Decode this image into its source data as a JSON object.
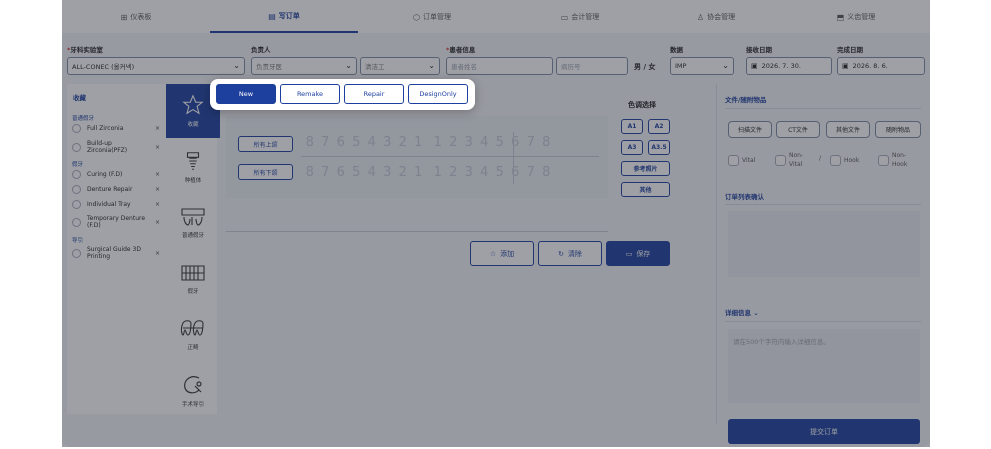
{
  "nav": {
    "tabs": [
      {
        "label": "仪表板",
        "icon": "grid-icon"
      },
      {
        "label": "写订单",
        "icon": "document-icon"
      },
      {
        "label": "订单管理",
        "icon": "box-icon"
      },
      {
        "label": "会计管理",
        "icon": "card-icon"
      },
      {
        "label": "协会管理",
        "icon": "user-icon"
      },
      {
        "label": "义齿管理",
        "icon": "cube-icon"
      }
    ],
    "active_tab": "写订单"
  },
  "form": {
    "lab_label": "牙科实验室",
    "lab_value": "ALL-CONEC (올커넥)",
    "owner_label": "负责人",
    "owner_placeholder": "负责牙医",
    "cleaner_value": "清洁工",
    "patient_label": "患者信息",
    "patient_name_placeholder": "患者姓名",
    "record_placeholder": "病历号",
    "gender_male": "男",
    "gender_sep": "/",
    "gender_female": "女",
    "data_label": "数据",
    "data_value": "IMP",
    "received_label": "接收日期",
    "received_value": "2026. 7. 30.",
    "completed_label": "完成日期",
    "completed_value": "2026. 8. 6."
  },
  "favorites": {
    "title": "收藏",
    "groups": [
      {
        "name": "普通假牙",
        "items": [
          "Full Zirconia",
          "Build-up Zirconia(PFZ)"
        ]
      },
      {
        "name": "假牙",
        "items": [
          "Curing (F.D)",
          "Denture Repair",
          "Individual Tray",
          "Temporary Denture (F.D)"
        ]
      },
      {
        "name": "导引",
        "items": [
          "Surgical Guide 3D Printing"
        ]
      }
    ],
    "remove_symbol": "×"
  },
  "categories": [
    {
      "label": "收藏",
      "icon": "star-icon"
    },
    {
      "label": "种植体",
      "icon": "implant-icon"
    },
    {
      "label": "普通假牙",
      "icon": "crown-bridge-icon"
    },
    {
      "label": "假牙",
      "icon": "denture-icon"
    },
    {
      "label": "正畸",
      "icon": "orthodontic-icon"
    },
    {
      "label": "手术导引",
      "icon": "surgical-guide-icon"
    }
  ],
  "teeth": {
    "upper_all": "所有上颌",
    "lower_all": "所有下颌",
    "upper_left": [
      "8",
      "7",
      "6",
      "5",
      "4",
      "3",
      "2",
      "1"
    ],
    "upper_right": [
      "1",
      "2",
      "3",
      "4",
      "5",
      "6",
      "7",
      "8"
    ],
    "lower_left": [
      "8",
      "7",
      "6",
      "5",
      "4",
      "3",
      "2",
      "1"
    ],
    "lower_right": [
      "1",
      "2",
      "3",
      "4",
      "5",
      "6",
      "7",
      "8"
    ]
  },
  "shade": {
    "title": "色调选择",
    "buttons": [
      "A1",
      "A2",
      "A3",
      "A3.5"
    ],
    "reference": "参考照片",
    "other": "其他"
  },
  "actions": {
    "add": "添加",
    "clear": "清除",
    "save": "保存"
  },
  "right": {
    "files_title": "文件/随附物品",
    "file_buttons": [
      "扫描文件",
      "CT文件",
      "其他文件",
      "随附物品"
    ],
    "vital": "Vital",
    "nonvital": "Non-Vital",
    "sep": "/",
    "hook": "Hook",
    "nonhook": "Non-Hook",
    "order_confirm": "订单列表确认",
    "details_title": "详细信息",
    "details_placeholder": "请在500个字符内输入详细信息。",
    "submit": "提交订单"
  },
  "popup": {
    "options": [
      "New",
      "Remake",
      "Repair",
      "DesignOnly"
    ],
    "selected": "New"
  },
  "colors": {
    "primary": "#1d3f9e",
    "accent_required": "#d92e2e"
  }
}
